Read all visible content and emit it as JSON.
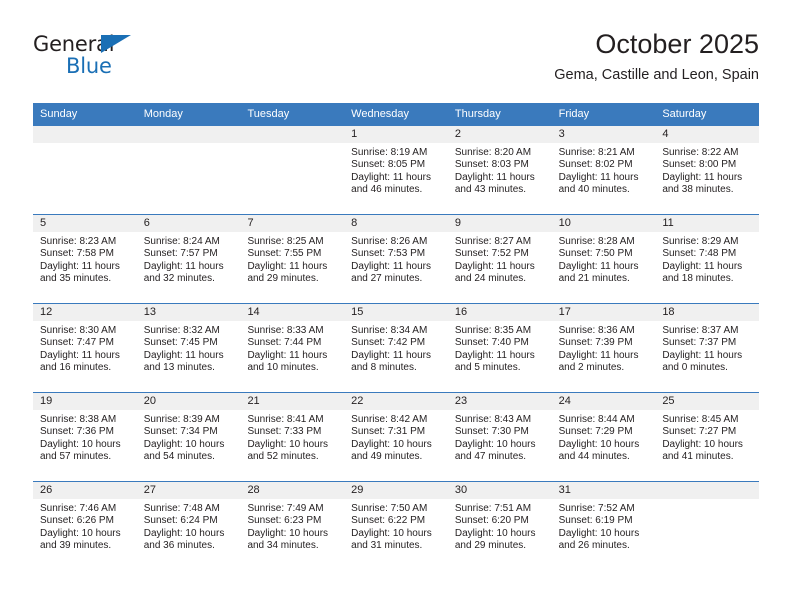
{
  "brand": {
    "name_top": "General",
    "name_bottom": "Blue",
    "accent_color": "#1a6fb5"
  },
  "header": {
    "title": "October 2025",
    "subtitle": "Gema, Castille and Leon, Spain"
  },
  "theme": {
    "header_blue": "#3a7abd",
    "day_band_gray": "#f0f0f0",
    "text_color": "#231f20"
  },
  "weekdays": [
    "Sunday",
    "Monday",
    "Tuesday",
    "Wednesday",
    "Thursday",
    "Friday",
    "Saturday"
  ],
  "labels": {
    "sunrise_prefix": "Sunrise: ",
    "sunset_prefix": "Sunset: ",
    "daylight_prefix": "Daylight: "
  },
  "weeks": [
    [
      {
        "day": "",
        "empty": true
      },
      {
        "day": "",
        "empty": true
      },
      {
        "day": "",
        "empty": true
      },
      {
        "day": "1",
        "sunrise": "Sunrise: 8:19 AM",
        "sunset": "Sunset: 8:05 PM",
        "daylight_line1": "Daylight: 11 hours",
        "daylight_line2": "and 46 minutes."
      },
      {
        "day": "2",
        "sunrise": "Sunrise: 8:20 AM",
        "sunset": "Sunset: 8:03 PM",
        "daylight_line1": "Daylight: 11 hours",
        "daylight_line2": "and 43 minutes."
      },
      {
        "day": "3",
        "sunrise": "Sunrise: 8:21 AM",
        "sunset": "Sunset: 8:02 PM",
        "daylight_line1": "Daylight: 11 hours",
        "daylight_line2": "and 40 minutes."
      },
      {
        "day": "4",
        "sunrise": "Sunrise: 8:22 AM",
        "sunset": "Sunset: 8:00 PM",
        "daylight_line1": "Daylight: 11 hours",
        "daylight_line2": "and 38 minutes."
      }
    ],
    [
      {
        "day": "5",
        "sunrise": "Sunrise: 8:23 AM",
        "sunset": "Sunset: 7:58 PM",
        "daylight_line1": "Daylight: 11 hours",
        "daylight_line2": "and 35 minutes."
      },
      {
        "day": "6",
        "sunrise": "Sunrise: 8:24 AM",
        "sunset": "Sunset: 7:57 PM",
        "daylight_line1": "Daylight: 11 hours",
        "daylight_line2": "and 32 minutes."
      },
      {
        "day": "7",
        "sunrise": "Sunrise: 8:25 AM",
        "sunset": "Sunset: 7:55 PM",
        "daylight_line1": "Daylight: 11 hours",
        "daylight_line2": "and 29 minutes."
      },
      {
        "day": "8",
        "sunrise": "Sunrise: 8:26 AM",
        "sunset": "Sunset: 7:53 PM",
        "daylight_line1": "Daylight: 11 hours",
        "daylight_line2": "and 27 minutes."
      },
      {
        "day": "9",
        "sunrise": "Sunrise: 8:27 AM",
        "sunset": "Sunset: 7:52 PM",
        "daylight_line1": "Daylight: 11 hours",
        "daylight_line2": "and 24 minutes."
      },
      {
        "day": "10",
        "sunrise": "Sunrise: 8:28 AM",
        "sunset": "Sunset: 7:50 PM",
        "daylight_line1": "Daylight: 11 hours",
        "daylight_line2": "and 21 minutes."
      },
      {
        "day": "11",
        "sunrise": "Sunrise: 8:29 AM",
        "sunset": "Sunset: 7:48 PM",
        "daylight_line1": "Daylight: 11 hours",
        "daylight_line2": "and 18 minutes."
      }
    ],
    [
      {
        "day": "12",
        "sunrise": "Sunrise: 8:30 AM",
        "sunset": "Sunset: 7:47 PM",
        "daylight_line1": "Daylight: 11 hours",
        "daylight_line2": "and 16 minutes."
      },
      {
        "day": "13",
        "sunrise": "Sunrise: 8:32 AM",
        "sunset": "Sunset: 7:45 PM",
        "daylight_line1": "Daylight: 11 hours",
        "daylight_line2": "and 13 minutes."
      },
      {
        "day": "14",
        "sunrise": "Sunrise: 8:33 AM",
        "sunset": "Sunset: 7:44 PM",
        "daylight_line1": "Daylight: 11 hours",
        "daylight_line2": "and 10 minutes."
      },
      {
        "day": "15",
        "sunrise": "Sunrise: 8:34 AM",
        "sunset": "Sunset: 7:42 PM",
        "daylight_line1": "Daylight: 11 hours",
        "daylight_line2": "and 8 minutes."
      },
      {
        "day": "16",
        "sunrise": "Sunrise: 8:35 AM",
        "sunset": "Sunset: 7:40 PM",
        "daylight_line1": "Daylight: 11 hours",
        "daylight_line2": "and 5 minutes."
      },
      {
        "day": "17",
        "sunrise": "Sunrise: 8:36 AM",
        "sunset": "Sunset: 7:39 PM",
        "daylight_line1": "Daylight: 11 hours",
        "daylight_line2": "and 2 minutes."
      },
      {
        "day": "18",
        "sunrise": "Sunrise: 8:37 AM",
        "sunset": "Sunset: 7:37 PM",
        "daylight_line1": "Daylight: 11 hours",
        "daylight_line2": "and 0 minutes."
      }
    ],
    [
      {
        "day": "19",
        "sunrise": "Sunrise: 8:38 AM",
        "sunset": "Sunset: 7:36 PM",
        "daylight_line1": "Daylight: 10 hours",
        "daylight_line2": "and 57 minutes."
      },
      {
        "day": "20",
        "sunrise": "Sunrise: 8:39 AM",
        "sunset": "Sunset: 7:34 PM",
        "daylight_line1": "Daylight: 10 hours",
        "daylight_line2": "and 54 minutes."
      },
      {
        "day": "21",
        "sunrise": "Sunrise: 8:41 AM",
        "sunset": "Sunset: 7:33 PM",
        "daylight_line1": "Daylight: 10 hours",
        "daylight_line2": "and 52 minutes."
      },
      {
        "day": "22",
        "sunrise": "Sunrise: 8:42 AM",
        "sunset": "Sunset: 7:31 PM",
        "daylight_line1": "Daylight: 10 hours",
        "daylight_line2": "and 49 minutes."
      },
      {
        "day": "23",
        "sunrise": "Sunrise: 8:43 AM",
        "sunset": "Sunset: 7:30 PM",
        "daylight_line1": "Daylight: 10 hours",
        "daylight_line2": "and 47 minutes."
      },
      {
        "day": "24",
        "sunrise": "Sunrise: 8:44 AM",
        "sunset": "Sunset: 7:29 PM",
        "daylight_line1": "Daylight: 10 hours",
        "daylight_line2": "and 44 minutes."
      },
      {
        "day": "25",
        "sunrise": "Sunrise: 8:45 AM",
        "sunset": "Sunset: 7:27 PM",
        "daylight_line1": "Daylight: 10 hours",
        "daylight_line2": "and 41 minutes."
      }
    ],
    [
      {
        "day": "26",
        "sunrise": "Sunrise: 7:46 AM",
        "sunset": "Sunset: 6:26 PM",
        "daylight_line1": "Daylight: 10 hours",
        "daylight_line2": "and 39 minutes."
      },
      {
        "day": "27",
        "sunrise": "Sunrise: 7:48 AM",
        "sunset": "Sunset: 6:24 PM",
        "daylight_line1": "Daylight: 10 hours",
        "daylight_line2": "and 36 minutes."
      },
      {
        "day": "28",
        "sunrise": "Sunrise: 7:49 AM",
        "sunset": "Sunset: 6:23 PM",
        "daylight_line1": "Daylight: 10 hours",
        "daylight_line2": "and 34 minutes."
      },
      {
        "day": "29",
        "sunrise": "Sunrise: 7:50 AM",
        "sunset": "Sunset: 6:22 PM",
        "daylight_line1": "Daylight: 10 hours",
        "daylight_line2": "and 31 minutes."
      },
      {
        "day": "30",
        "sunrise": "Sunrise: 7:51 AM",
        "sunset": "Sunset: 6:20 PM",
        "daylight_line1": "Daylight: 10 hours",
        "daylight_line2": "and 29 minutes."
      },
      {
        "day": "31",
        "sunrise": "Sunrise: 7:52 AM",
        "sunset": "Sunset: 6:19 PM",
        "daylight_line1": "Daylight: 10 hours",
        "daylight_line2": "and 26 minutes."
      },
      {
        "day": "",
        "empty": true
      }
    ]
  ]
}
